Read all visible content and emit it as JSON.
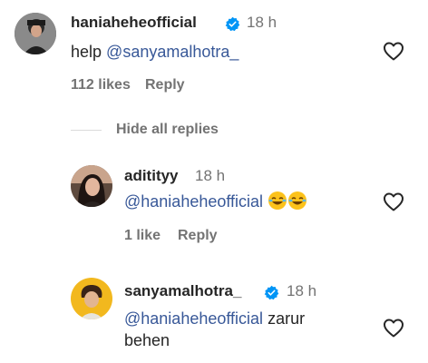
{
  "comment": {
    "username": "haniahehe​official",
    "time": "18 h",
    "text_prefix": "help ",
    "mention": "@sanyamalhotra_",
    "likes": "112 likes",
    "reply": "Reply"
  },
  "replies_toggle": "Hide all replies",
  "replies": [
    {
      "username": "aditityy",
      "time": "18 h",
      "mention": "@haniahehe​official",
      "likes": "1 like",
      "reply": "Reply"
    },
    {
      "username": "sanyamalhotra_",
      "time": "18 h",
      "mention": "@haniahehe​official",
      "text_suffix": " zarur behen"
    }
  ],
  "colors": {
    "mention": "#385898",
    "verified": "#0095f6",
    "muted": "#737373",
    "text": "#262626"
  },
  "icons": [
    "verified-badge-icon",
    "heart-outline-icon",
    "laughing-emoji-icon"
  ]
}
